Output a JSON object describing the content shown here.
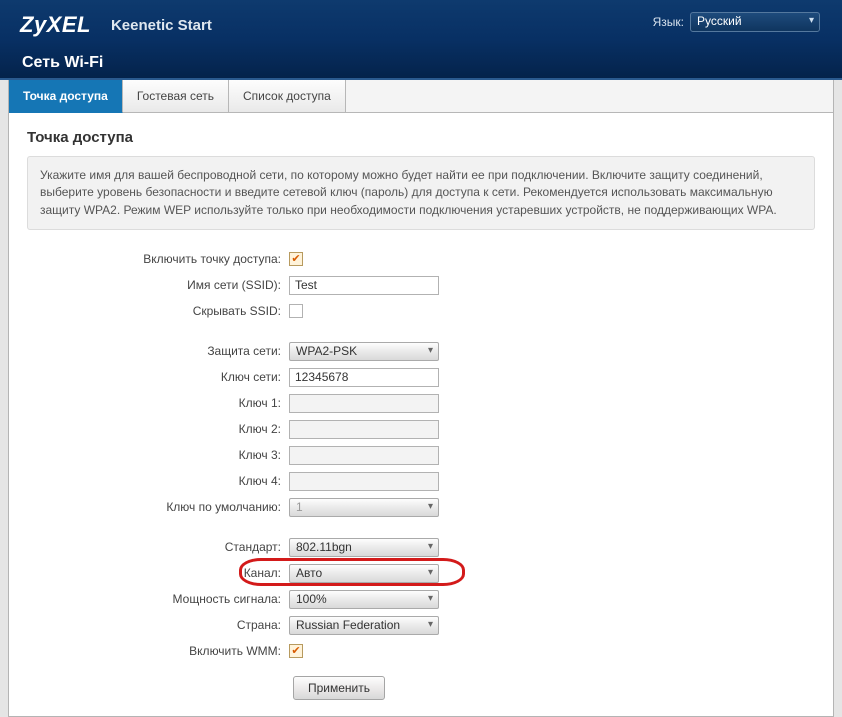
{
  "header": {
    "logo": "ZyXEL",
    "model": "Keenetic Start",
    "lang_label": "Язык:",
    "lang_value": "Русский",
    "page_title": "Сеть Wi-Fi"
  },
  "tabs": [
    {
      "label": "Точка доступа",
      "active": true
    },
    {
      "label": "Гостевая сеть",
      "active": false
    },
    {
      "label": "Список доступа",
      "active": false
    }
  ],
  "section_title": "Точка доступа",
  "description": "Укажите имя для вашей беспроводной сети, по которому можно будет найти ее при подключении. Включите защиту соединений, выберите уровень безопасности и введите сетевой ключ (пароль) для доступа к сети. Рекомендуется использовать максимальную защиту WPA2. Режим WEP используйте только при необходимости подключения устаревших устройств, не поддерживающих WPA.",
  "labels": {
    "enable_ap": "Включить точку доступа:",
    "ssid": "Имя сети (SSID):",
    "hide_ssid": "Скрывать SSID:",
    "security": "Защита сети:",
    "net_key": "Ключ сети:",
    "key1": "Ключ 1:",
    "key2": "Ключ 2:",
    "key3": "Ключ 3:",
    "key4": "Ключ 4:",
    "default_key": "Ключ по умолчанию:",
    "standard": "Стандарт:",
    "channel": "Канал:",
    "power": "Мощность сигнала:",
    "country": "Страна:",
    "wmm": "Включить WMM:"
  },
  "values": {
    "ssid": "Test",
    "security": "WPA2-PSK",
    "net_key": "12345678",
    "default_key": "1",
    "standard": "802.11bgn",
    "channel": "Авто",
    "power": "100%",
    "country": "Russian Federation"
  },
  "buttons": {
    "apply": "Применить"
  },
  "checks": {
    "enable_ap": true,
    "hide_ssid": false,
    "wmm": true
  }
}
